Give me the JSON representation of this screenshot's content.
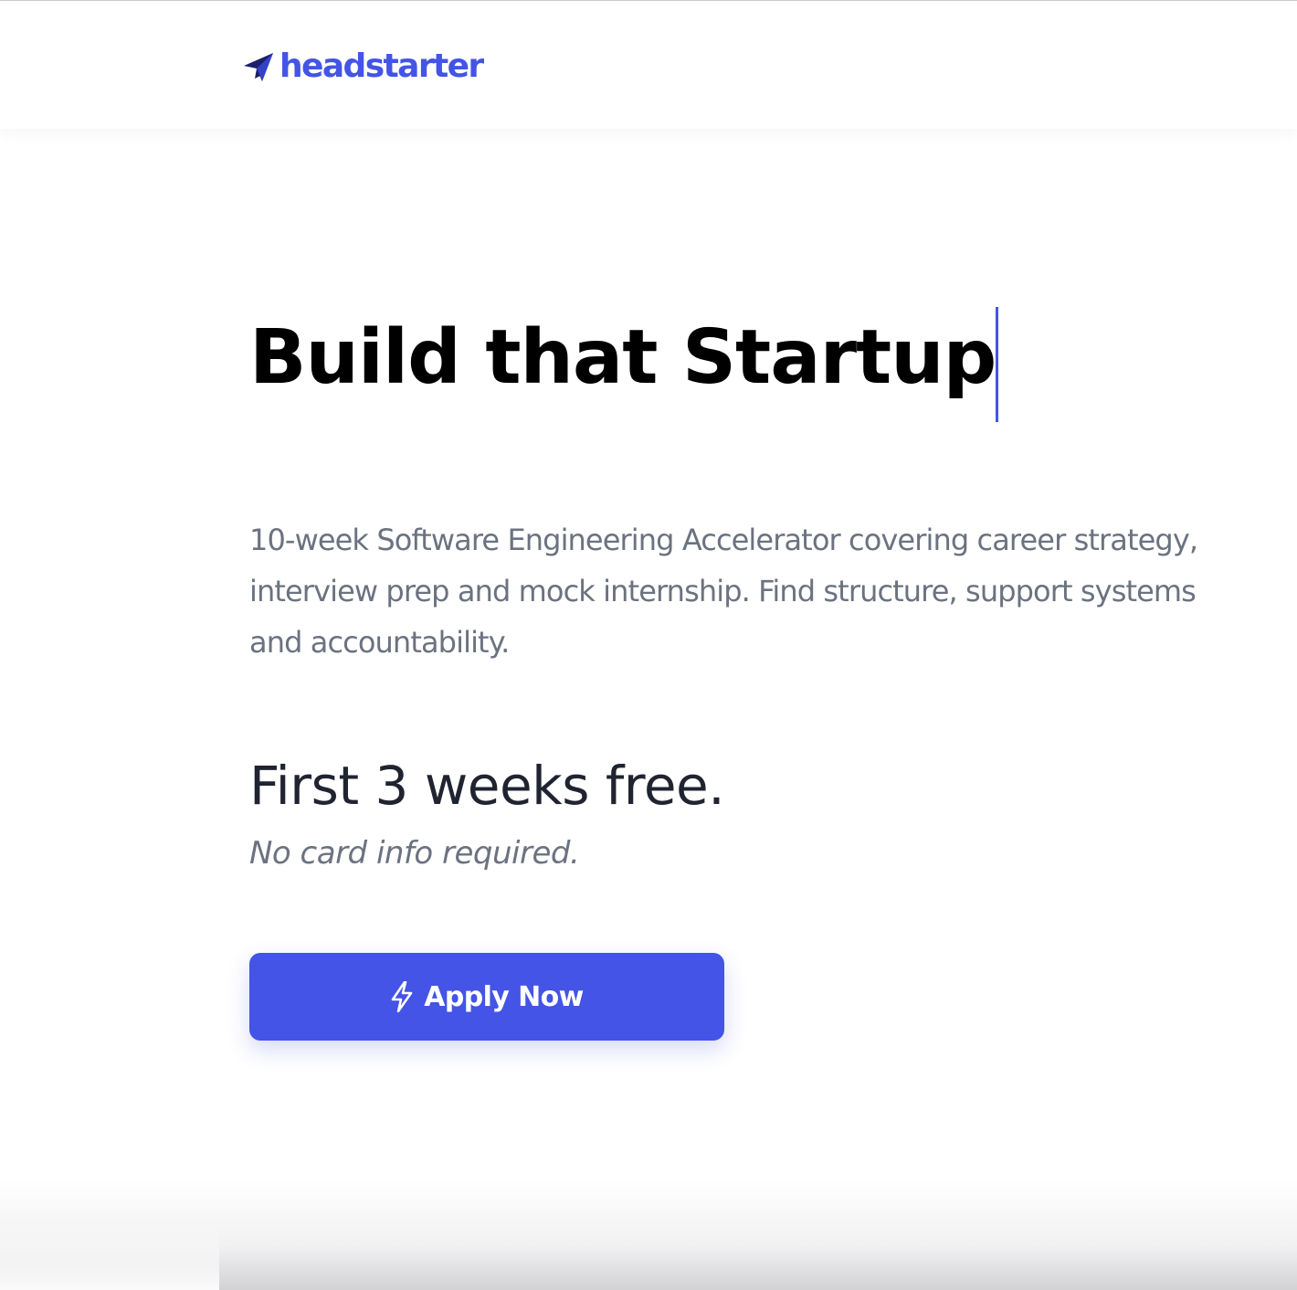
{
  "brand": {
    "name": "headstarter",
    "logo_icon": "paper-plane-icon",
    "color": "#4354e6"
  },
  "hero": {
    "title": "Build that Startup",
    "description": "10-week Software Engineering Accelerator covering career strategy, interview prep and mock internship. Find structure, support systems and accountability.",
    "offer_title": "First 3 weeks free.",
    "offer_subtitle": "No card info required.",
    "cta": {
      "label": "Apply Now",
      "icon": "bolt-icon",
      "color": "#4354e6"
    }
  }
}
